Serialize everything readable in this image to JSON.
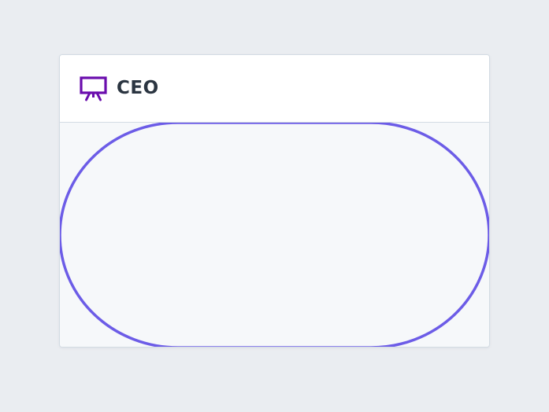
{
  "node": {
    "title": "CEO",
    "icon": "presentation-board-icon"
  },
  "colors": {
    "icon": "#6a0dad",
    "title": "#2b3541",
    "shape_stroke": "#6c5ce7",
    "header_bg": "#ffffff",
    "body_bg": "#f6f8fa",
    "border": "#d3dbe3",
    "page_bg": "#eaedf1"
  }
}
